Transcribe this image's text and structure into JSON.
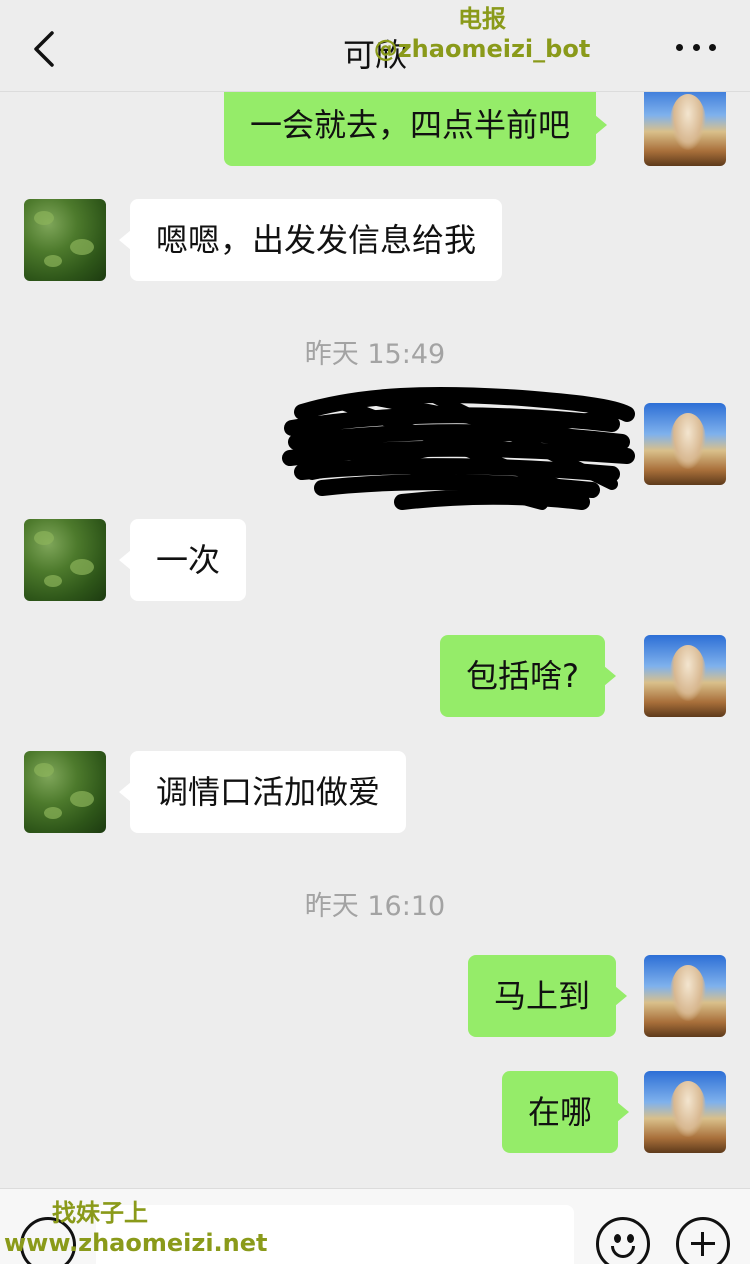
{
  "header": {
    "title": "可欣",
    "back_icon": "chevron-left-icon",
    "more_icon": "more-horizontal-icon"
  },
  "watermarks": {
    "top_line1": "电报",
    "top_line2": "@zhaomeizi_bot",
    "bottom_line1": "找妹子上",
    "bottom_line2": "www.zhaomeizi.net"
  },
  "messages": [
    {
      "side": "self",
      "text": "一会就去，四点半前吧"
    },
    {
      "side": "other",
      "text": "嗯嗯，出发发信息给我"
    },
    {
      "side": "self",
      "text": "",
      "redacted": true
    },
    {
      "side": "other",
      "text": "一次"
    },
    {
      "side": "self",
      "text": "包括啥?"
    },
    {
      "side": "other",
      "text": "调情口活加做爱"
    },
    {
      "side": "self",
      "text": "马上到"
    },
    {
      "side": "self",
      "text": "在哪"
    }
  ],
  "timestamps": [
    "昨天 15:49",
    "昨天 16:10"
  ],
  "colors": {
    "background": "#ededed",
    "self_bubble": "#95ec69",
    "other_bubble": "#ffffff",
    "watermark": "#8a9a1a"
  },
  "input_bar": {
    "voice_icon": "voice-icon",
    "emoji_icon": "emoji-icon",
    "plus_icon": "plus-icon"
  }
}
